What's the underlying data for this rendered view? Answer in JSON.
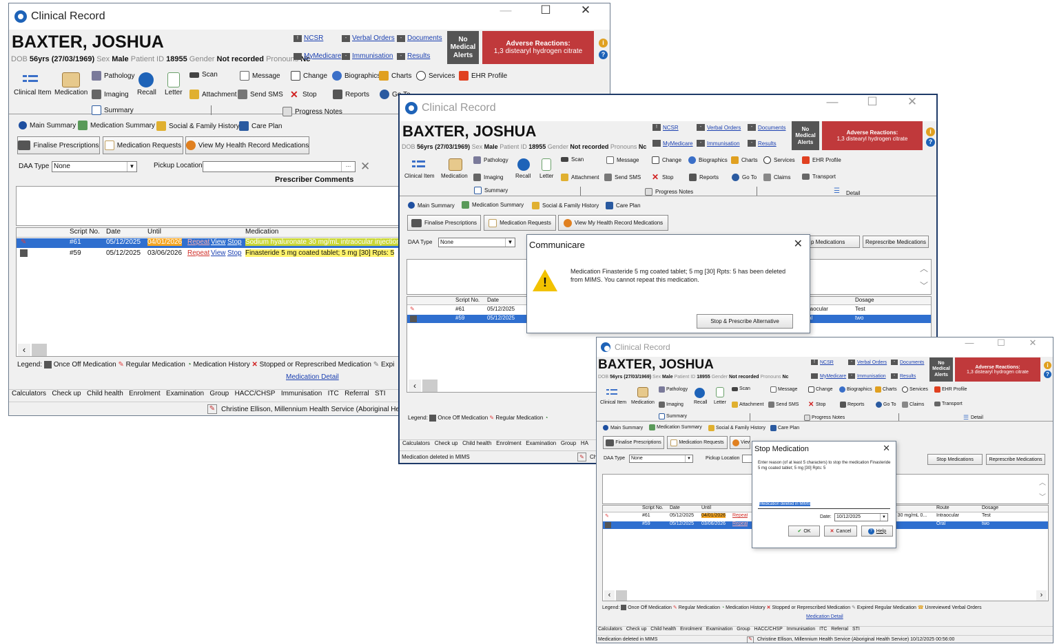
{
  "app_title": "Clinical Record",
  "window_controls": {
    "minimize": "—",
    "maximize": "☐",
    "close": "✕"
  },
  "patient": {
    "name": "BAXTER, JOSHUA",
    "dob_label": "DOB",
    "age": "56yrs",
    "dob": "(27/03/1969)",
    "sex_label": "Sex",
    "sex": "Male",
    "id_label": "Patient ID",
    "id": "18955",
    "gender_label": "Gender",
    "gender": "Not recorded",
    "pronouns_label": "Pronouns",
    "pronouns_value": "Nc"
  },
  "header_links": {
    "ncsr": "NCSR",
    "verbal_orders": "Verbal Orders",
    "documents": "Documents",
    "mymedicare": "MyMedicare",
    "immunisation": "Immunisation",
    "results": "Results"
  },
  "alerts": {
    "no_medical_alerts": "No Medical Alerts",
    "adverse_title": "Adverse Reactions:",
    "adverse_value": "1,3 distearyl hydrogen citrate"
  },
  "toolbar": {
    "clinical_item": "Clinical Item",
    "medication": "Medication",
    "pathology": "Pathology",
    "imaging": "Imaging",
    "recall": "Recall",
    "letter": "Letter",
    "scan": "Scan",
    "attachment": "Attachment",
    "message": "Message",
    "send_sms": "Send SMS",
    "change": "Change",
    "stop": "Stop",
    "biographics": "Biographics",
    "charts": "Charts",
    "services": "Services",
    "ehr_profile": "EHR Profile",
    "reports": "Reports",
    "go_to": "Go To",
    "claims": "Claims",
    "transport": "Transport"
  },
  "main_tabs": {
    "summary": "Summary",
    "progress_notes": "Progress Notes",
    "detail": "Detail"
  },
  "sub_tabs": {
    "main_summary": "Main Summary",
    "medication_summary": "Medication Summary",
    "social_family_history": "Social & Family History",
    "care_plan": "Care Plan"
  },
  "med_buttons": {
    "finalise_prescriptions": "Finalise Prescriptions",
    "medication_requests": "Medication Requests",
    "view_mhr_medications": "View My Health Record Medications",
    "stop_medications": "Stop Medications",
    "represcribe_medications": "Represcribe Medications"
  },
  "daa": {
    "label": "DAA Type",
    "value": "None",
    "pickup_label": "Pickup Location",
    "pickup_value": "",
    "prescriber_comments": "Prescriber Comments"
  },
  "grid": {
    "headers": {
      "script_no": "Script No.",
      "date": "Date",
      "until": "Until",
      "medication": "Medication",
      "route": "Route",
      "dosage": "Dosage"
    },
    "rows": [
      {
        "script_no": "#61",
        "date": "05/12/2025",
        "until": "04/01/2026",
        "repeat": "Repeat",
        "view": "View",
        "stop": "Stop",
        "medication": "Sodium hyaluronate 30 mg/mL intraocular injection 0.6",
        "route": "Intraocular",
        "route_partial": "raocular",
        "dosage": "Test",
        "med_tail": "nL; 30 mg/mL 0..."
      },
      {
        "script_no": "#59",
        "date": "05/12/2025",
        "until": "03/06/2026",
        "repeat": "Repeat",
        "view": "View",
        "stop": "Stop",
        "medication": "Finasteride 5 mg coated tablet; 5 mg [30] Rpts: 5",
        "route": "Oral",
        "route_partial": "al",
        "dosage": "two"
      }
    ]
  },
  "legend": {
    "label": "Legend:",
    "once_off": "Once Off Medication",
    "regular": "Regular Medication",
    "history": "Medication History",
    "stopped": "Stopped or Represcribed Medication",
    "expired": "Expired Regular Medication",
    "expired_partial": "Expi",
    "unreviewed": "Unreviewed Verbal Orders",
    "detail_link": "Medication Detail"
  },
  "bottom_tabs": [
    "Calculators",
    "Check up",
    "Child health",
    "Enrolment",
    "Examination",
    "Group",
    "HACC/CHSP",
    "Immunisation",
    "ITC",
    "Referral",
    "STI"
  ],
  "bottom_tabs_partial": {
    "ha": "HA"
  },
  "status": {
    "user": "Christine Ellison, Millennium Health Service (Aboriginal Health Service)",
    "user_partial_1": "Christine Ellison, Millennium Health Service (Aboriginal Health S",
    "user_partial_2": "Ch",
    "timestamp": "10/12/2025 00:56:00",
    "message": "Medication deleted in MIMS"
  },
  "communicare_dialog": {
    "title": "Communicare",
    "message": "Medication Finasteride 5 mg coated tablet; 5 mg [30] Rpts: 5 has been deleted from MIMS. You cannot repeat this medication.",
    "button": "Stop & Prescribe Alternative",
    "partial_button_text": "p Medications"
  },
  "stop_dialog": {
    "title": "Stop Medication",
    "prompt": "Enter reason (of at least 5 characters) to stop the medication Finasteride 5 mg coated tablet; 5 mg [30] Rpts: 5",
    "reason_value": "Medication deleted in MIMS",
    "date_label": "Date:",
    "date_value": "10/12/2025",
    "ok": "OK",
    "cancel": "Cancel",
    "help": "Help"
  },
  "colors": {
    "adverse_red": "#c0393b",
    "selection_blue": "#2f6fcf",
    "highlight_yellow": "#fff36b",
    "until_orange": "#f5a623",
    "link_blue": "#1a3fb0"
  }
}
